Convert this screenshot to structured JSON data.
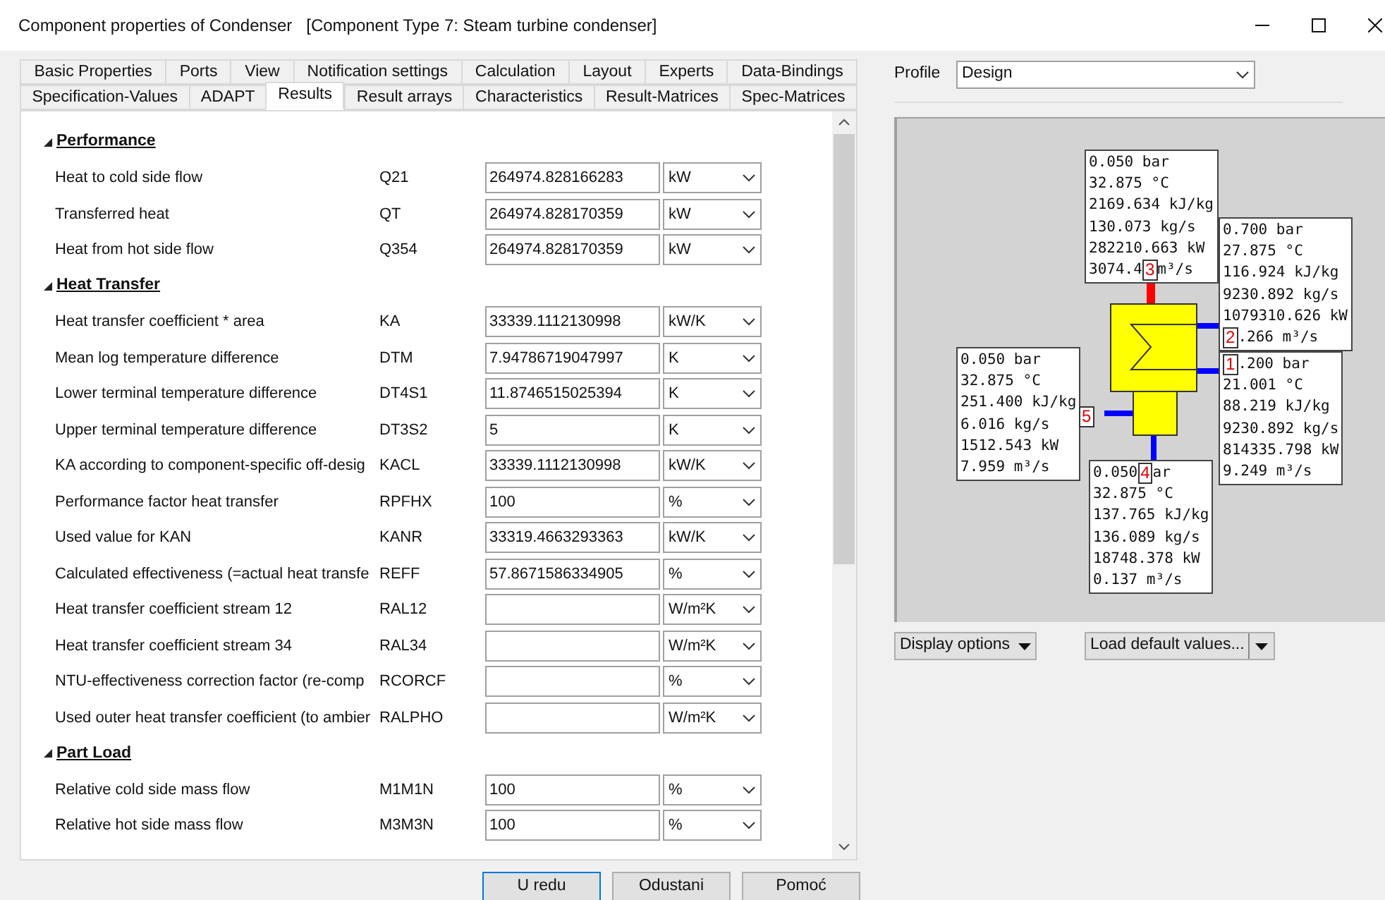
{
  "window": {
    "title": "Component properties of Condenser   [Component Type 7: Steam turbine condenser]"
  },
  "tab_rows": [
    [
      {
        "label": "Basic Properties",
        "selected": false
      },
      {
        "label": "Ports",
        "selected": false
      },
      {
        "label": "View",
        "selected": false
      },
      {
        "label": "Notification settings",
        "selected": false
      },
      {
        "label": "Calculation",
        "selected": false
      },
      {
        "label": "Layout",
        "selected": false
      },
      {
        "label": "Experts",
        "selected": false
      },
      {
        "label": "Data-Bindings",
        "selected": false
      }
    ],
    [
      {
        "label": "Specification-Values",
        "selected": false
      },
      {
        "label": "ADAPT",
        "selected": false
      },
      {
        "label": "Results",
        "selected": true
      },
      {
        "label": "Result arrays",
        "selected": false
      },
      {
        "label": "Characteristics",
        "selected": false
      },
      {
        "label": "Result-Matrices",
        "selected": false
      },
      {
        "label": "Spec-Matrices",
        "selected": false
      }
    ]
  ],
  "sections": [
    {
      "title": "Performance",
      "expanded": true,
      "rows": [
        {
          "label": "Heat to cold side flow",
          "code": "Q21",
          "value": "264974.828166283",
          "unit": "kW"
        },
        {
          "label": "Transferred heat",
          "code": "QT",
          "value": "264974.828170359",
          "unit": "kW"
        },
        {
          "label": "Heat from hot side flow",
          "code": "Q354",
          "value": "264974.828170359",
          "unit": "kW"
        }
      ]
    },
    {
      "title": "Heat Transfer",
      "expanded": true,
      "rows": [
        {
          "label": "Heat transfer coefficient * area",
          "code": "KA",
          "value": "33339.1112130998",
          "unit": "kW/K"
        },
        {
          "label": "Mean log temperature difference",
          "code": "DTM",
          "value": "7.94786719047997",
          "unit": "K"
        },
        {
          "label": "Lower terminal temperature difference",
          "code": "DT4S1",
          "value": "11.8746515025394",
          "unit": "K"
        },
        {
          "label": "Upper terminal temperature difference",
          "code": "DT3S2",
          "value": "5",
          "unit": "K"
        },
        {
          "label": "KA according to component-specific off-desig",
          "code": "KACL",
          "value": "33339.1112130998",
          "unit": "kW/K"
        },
        {
          "label": "Performance factor heat transfer",
          "code": "RPFHX",
          "value": "100",
          "unit": "%"
        },
        {
          "label": "Used value for KAN",
          "code": "KANR",
          "value": "33319.4663293363",
          "unit": "kW/K"
        },
        {
          "label": "Calculated effectiveness (=actual heat transfe",
          "code": "REFF",
          "value": "57.8671586334905",
          "unit": "%"
        },
        {
          "label": "Heat transfer coefficient stream 12",
          "code": "RAL12",
          "unit": "W/m²K"
        },
        {
          "label": "Heat transfer coefficient stream 34",
          "code": "RAL34",
          "unit": "W/m²K"
        },
        {
          "label": "NTU-effectiveness correction factor (re-comp",
          "code": "RCORCF",
          "unit": "%"
        },
        {
          "label": "Used outer heat transfer coefficient (to ambier",
          "code": "RALPHO",
          "unit": "W/m²K"
        }
      ]
    },
    {
      "title": "Part Load",
      "expanded": true,
      "rows": [
        {
          "label": "Relative cold side mass flow",
          "code": "M1M1N",
          "value": "100",
          "unit": "%"
        },
        {
          "label": "Relative hot side mass flow",
          "code": "M3M3N",
          "value": "100",
          "unit": "%"
        }
      ]
    }
  ],
  "buttons": [
    "U redu",
    "Odustani",
    "Pomoć"
  ],
  "profile": {
    "label": "Profile",
    "value": "Design"
  },
  "diagram": {
    "boxes": [
      {
        "port": "3",
        "lines": [
          "0.050 bar",
          "32.875 °C",
          "2169.634 kJ/kg",
          "130.073 kg/s",
          "282210.663 kW",
          {
            "before": "3074.4",
            "after": " m³/s"
          }
        ]
      },
      {
        "port": "2",
        "lines": [
          "0.700 bar",
          "27.875 °C",
          "116.924 kJ/kg",
          "9230.892 kg/s",
          "1079310.626 kW",
          {
            "after": ".266 m³/s"
          }
        ]
      },
      {
        "port": "5",
        "lines": [
          "0.050 bar",
          "32.875 °C",
          "251.400 kJ/kg",
          "6.016 kg/s",
          "1512.543 kW",
          "7.959 m³/s"
        ]
      },
      {
        "port": "1",
        "lines": [
          {
            "after": ".200 bar"
          },
          "21.001 °C",
          "88.219 kJ/kg",
          "9230.892 kg/s",
          "814335.798 kW",
          "9.249 m³/s"
        ]
      },
      {
        "port": "4",
        "lines": [
          {
            "before": "0.050 ",
            "after": "ar"
          },
          "32.875 °C",
          "137.765 kJ/kg",
          "136.089 kg/s",
          "18748.378 kW",
          "0.137 m³/s"
        ]
      }
    ]
  },
  "display_options": "Display options",
  "load_defaults": "Load default values..."
}
